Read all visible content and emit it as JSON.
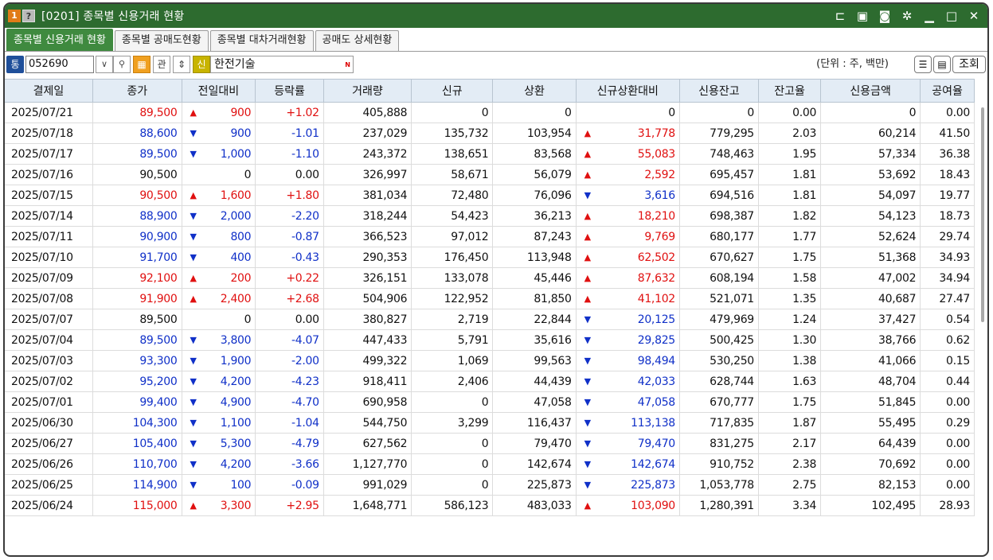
{
  "window": {
    "badge_number": "1",
    "badge_help": "?",
    "title": "[0201] 종목별 신용거래 현황"
  },
  "tabs": [
    "종목별 신용거래 현황",
    "종목별 공매도현황",
    "종목별 대차거래현황",
    "공매도 상세현황"
  ],
  "toolbar": {
    "market_badge": "통",
    "code_value": "052690",
    "gwan_label": "관",
    "sin_label": "신",
    "stock_name": "한전기술",
    "n_mark": "N",
    "unit_text": "(단위 : 주, 백만)",
    "lookup_label": "조회"
  },
  "columns": [
    "결제일",
    "종가",
    "전일대비",
    "등락률",
    "거래량",
    "신규",
    "상환",
    "신규상환대비",
    "신용잔고",
    "잔고율",
    "신용금액",
    "공여율"
  ],
  "rows": [
    {
      "date": "2025/07/21",
      "close": "89,500",
      "cdir": "up",
      "chg_arrow": "▲",
      "chg": "900",
      "rate": "+1.02",
      "vol": "405,888",
      "new": "0",
      "repay": "0",
      "ndir": "flat",
      "n_arrow": "",
      "diff": "0",
      "bal": "0",
      "bal_rate": "0.00",
      "amount": "0",
      "supply": "0.00"
    },
    {
      "date": "2025/07/18",
      "close": "88,600",
      "cdir": "dn",
      "chg_arrow": "▼",
      "chg": "900",
      "rate": "-1.01",
      "vol": "237,029",
      "new": "135,732",
      "repay": "103,954",
      "ndir": "up",
      "n_arrow": "▲",
      "diff": "31,778",
      "bal": "779,295",
      "bal_rate": "2.03",
      "amount": "60,214",
      "supply": "41.50"
    },
    {
      "date": "2025/07/17",
      "close": "89,500",
      "cdir": "dn",
      "chg_arrow": "▼",
      "chg": "1,000",
      "rate": "-1.10",
      "vol": "243,372",
      "new": "138,651",
      "repay": "83,568",
      "ndir": "up",
      "n_arrow": "▲",
      "diff": "55,083",
      "bal": "748,463",
      "bal_rate": "1.95",
      "amount": "57,334",
      "supply": "36.38"
    },
    {
      "date": "2025/07/16",
      "close": "90,500",
      "cdir": "flat",
      "chg_arrow": "",
      "chg": "0",
      "rate": "0.00",
      "vol": "326,997",
      "new": "58,671",
      "repay": "56,079",
      "ndir": "up",
      "n_arrow": "▲",
      "diff": "2,592",
      "bal": "695,457",
      "bal_rate": "1.81",
      "amount": "53,692",
      "supply": "18.43"
    },
    {
      "date": "2025/07/15",
      "close": "90,500",
      "cdir": "up",
      "chg_arrow": "▲",
      "chg": "1,600",
      "rate": "+1.80",
      "vol": "381,034",
      "new": "72,480",
      "repay": "76,096",
      "ndir": "dn",
      "n_arrow": "▼",
      "diff": "3,616",
      "bal": "694,516",
      "bal_rate": "1.81",
      "amount": "54,097",
      "supply": "19.77"
    },
    {
      "date": "2025/07/14",
      "close": "88,900",
      "cdir": "dn",
      "chg_arrow": "▼",
      "chg": "2,000",
      "rate": "-2.20",
      "vol": "318,244",
      "new": "54,423",
      "repay": "36,213",
      "ndir": "up",
      "n_arrow": "▲",
      "diff": "18,210",
      "bal": "698,387",
      "bal_rate": "1.82",
      "amount": "54,123",
      "supply": "18.73"
    },
    {
      "date": "2025/07/11",
      "close": "90,900",
      "cdir": "dn",
      "chg_arrow": "▼",
      "chg": "800",
      "rate": "-0.87",
      "vol": "366,523",
      "new": "97,012",
      "repay": "87,243",
      "ndir": "up",
      "n_arrow": "▲",
      "diff": "9,769",
      "bal": "680,177",
      "bal_rate": "1.77",
      "amount": "52,624",
      "supply": "29.74"
    },
    {
      "date": "2025/07/10",
      "close": "91,700",
      "cdir": "dn",
      "chg_arrow": "▼",
      "chg": "400",
      "rate": "-0.43",
      "vol": "290,353",
      "new": "176,450",
      "repay": "113,948",
      "ndir": "up",
      "n_arrow": "▲",
      "diff": "62,502",
      "bal": "670,627",
      "bal_rate": "1.75",
      "amount": "51,368",
      "supply": "34.93"
    },
    {
      "date": "2025/07/09",
      "close": "92,100",
      "cdir": "up",
      "chg_arrow": "▲",
      "chg": "200",
      "rate": "+0.22",
      "vol": "326,151",
      "new": "133,078",
      "repay": "45,446",
      "ndir": "up",
      "n_arrow": "▲",
      "diff": "87,632",
      "bal": "608,194",
      "bal_rate": "1.58",
      "amount": "47,002",
      "supply": "34.94"
    },
    {
      "date": "2025/07/08",
      "close": "91,900",
      "cdir": "up",
      "chg_arrow": "▲",
      "chg": "2,400",
      "rate": "+2.68",
      "vol": "504,906",
      "new": "122,952",
      "repay": "81,850",
      "ndir": "up",
      "n_arrow": "▲",
      "diff": "41,102",
      "bal": "521,071",
      "bal_rate": "1.35",
      "amount": "40,687",
      "supply": "27.47"
    },
    {
      "date": "2025/07/07",
      "close": "89,500",
      "cdir": "flat",
      "chg_arrow": "",
      "chg": "0",
      "rate": "0.00",
      "vol": "380,827",
      "new": "2,719",
      "repay": "22,844",
      "ndir": "dn",
      "n_arrow": "▼",
      "diff": "20,125",
      "bal": "479,969",
      "bal_rate": "1.24",
      "amount": "37,427",
      "supply": "0.54"
    },
    {
      "date": "2025/07/04",
      "close": "89,500",
      "cdir": "dn",
      "chg_arrow": "▼",
      "chg": "3,800",
      "rate": "-4.07",
      "vol": "447,433",
      "new": "5,791",
      "repay": "35,616",
      "ndir": "dn",
      "n_arrow": "▼",
      "diff": "29,825",
      "bal": "500,425",
      "bal_rate": "1.30",
      "amount": "38,766",
      "supply": "0.62"
    },
    {
      "date": "2025/07/03",
      "close": "93,300",
      "cdir": "dn",
      "chg_arrow": "▼",
      "chg": "1,900",
      "rate": "-2.00",
      "vol": "499,322",
      "new": "1,069",
      "repay": "99,563",
      "ndir": "dn",
      "n_arrow": "▼",
      "diff": "98,494",
      "bal": "530,250",
      "bal_rate": "1.38",
      "amount": "41,066",
      "supply": "0.15"
    },
    {
      "date": "2025/07/02",
      "close": "95,200",
      "cdir": "dn",
      "chg_arrow": "▼",
      "chg": "4,200",
      "rate": "-4.23",
      "vol": "918,411",
      "new": "2,406",
      "repay": "44,439",
      "ndir": "dn",
      "n_arrow": "▼",
      "diff": "42,033",
      "bal": "628,744",
      "bal_rate": "1.63",
      "amount": "48,704",
      "supply": "0.44"
    },
    {
      "date": "2025/07/01",
      "close": "99,400",
      "cdir": "dn",
      "chg_arrow": "▼",
      "chg": "4,900",
      "rate": "-4.70",
      "vol": "690,958",
      "new": "0",
      "repay": "47,058",
      "ndir": "dn",
      "n_arrow": "▼",
      "diff": "47,058",
      "bal": "670,777",
      "bal_rate": "1.75",
      "amount": "51,845",
      "supply": "0.00"
    },
    {
      "date": "2025/06/30",
      "close": "104,300",
      "cdir": "dn",
      "chg_arrow": "▼",
      "chg": "1,100",
      "rate": "-1.04",
      "vol": "544,750",
      "new": "3,299",
      "repay": "116,437",
      "ndir": "dn",
      "n_arrow": "▼",
      "diff": "113,138",
      "bal": "717,835",
      "bal_rate": "1.87",
      "amount": "55,495",
      "supply": "0.29"
    },
    {
      "date": "2025/06/27",
      "close": "105,400",
      "cdir": "dn",
      "chg_arrow": "▼",
      "chg": "5,300",
      "rate": "-4.79",
      "vol": "627,562",
      "new": "0",
      "repay": "79,470",
      "ndir": "dn",
      "n_arrow": "▼",
      "diff": "79,470",
      "bal": "831,275",
      "bal_rate": "2.17",
      "amount": "64,439",
      "supply": "0.00"
    },
    {
      "date": "2025/06/26",
      "close": "110,700",
      "cdir": "dn",
      "chg_arrow": "▼",
      "chg": "4,200",
      "rate": "-3.66",
      "vol": "1,127,770",
      "new": "0",
      "repay": "142,674",
      "ndir": "dn",
      "n_arrow": "▼",
      "diff": "142,674",
      "bal": "910,752",
      "bal_rate": "2.38",
      "amount": "70,692",
      "supply": "0.00"
    },
    {
      "date": "2025/06/25",
      "close": "114,900",
      "cdir": "dn",
      "chg_arrow": "▼",
      "chg": "100",
      "rate": "-0.09",
      "vol": "991,029",
      "new": "0",
      "repay": "225,873",
      "ndir": "dn",
      "n_arrow": "▼",
      "diff": "225,873",
      "bal": "1,053,778",
      "bal_rate": "2.75",
      "amount": "82,153",
      "supply": "0.00"
    },
    {
      "date": "2025/06/24",
      "close": "115,000",
      "cdir": "up",
      "chg_arrow": "▲",
      "chg": "3,300",
      "rate": "+2.95",
      "vol": "1,648,771",
      "new": "586,123",
      "repay": "483,033",
      "ndir": "up",
      "n_arrow": "▲",
      "diff": "103,090",
      "bal": "1,280,391",
      "bal_rate": "3.34",
      "amount": "102,495",
      "supply": "28.93"
    }
  ]
}
